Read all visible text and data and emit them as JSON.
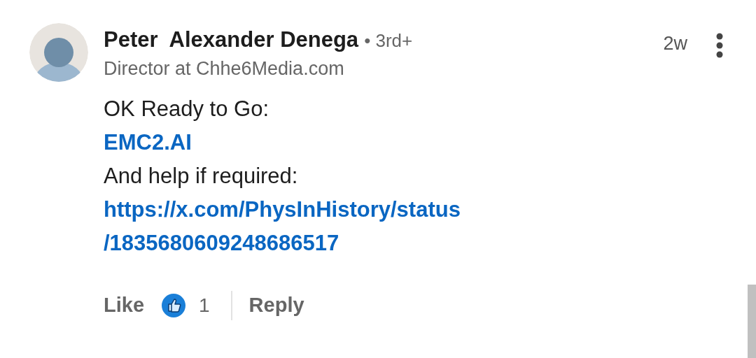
{
  "comment": {
    "author": "Peter  Alexander Denega",
    "degree": "• 3rd+",
    "headline": "Director at Chhe6Media.com",
    "time": "2w",
    "body": [
      {
        "kind": "text",
        "text": "OK Ready to Go:"
      },
      {
        "kind": "link",
        "text": "EMC2.AI"
      },
      {
        "kind": "text",
        "text": "And help if required:"
      },
      {
        "kind": "link",
        "text": "https://x.com/PhysInHistory/status"
      },
      {
        "kind": "link",
        "text": "/1835680609248686517"
      }
    ],
    "actions": {
      "like": "Like",
      "reaction_count": "1",
      "reply": "Reply"
    }
  }
}
